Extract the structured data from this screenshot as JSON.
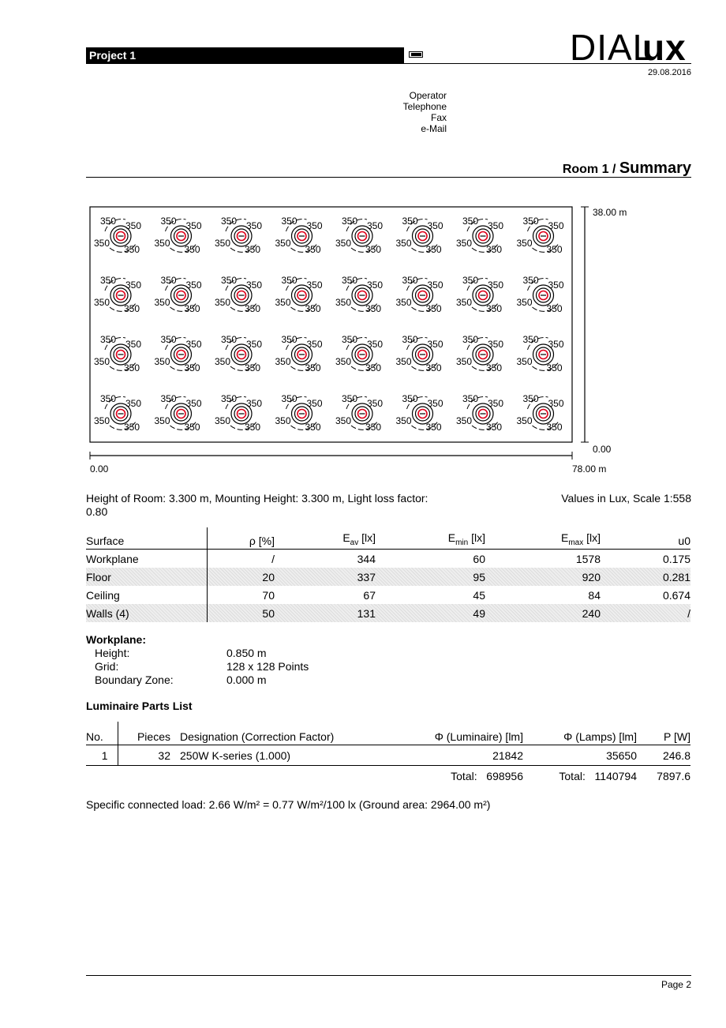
{
  "header": {
    "project": "Project 1",
    "logo": "DIALux",
    "date": "29.08.2016",
    "contact": [
      "Operator",
      "Telephone",
      "Fax",
      "e-Mail"
    ]
  },
  "section": {
    "room": "Room 1 /",
    "title": "Summary"
  },
  "plan": {
    "iso_label": "350",
    "y_max_label": "38.00 m",
    "y_min_label": "0.00",
    "x_min_label": "0.00",
    "x_max_label": "78.00 m",
    "luminaire_grid": {
      "columns": 8,
      "rows": 4
    },
    "luminaire_icon": "luminaire-symbol-icon"
  },
  "info": {
    "room_params": "Height of Room: 3.300 m, Mounting Height: 3.300 m, Light loss factor:",
    "room_params_2": "0.80",
    "scale": "Values in Lux, Scale 1:558"
  },
  "surfaces": {
    "headers": [
      "Surface",
      "ρ [%]",
      "E",
      "av",
      " [lx]",
      "E",
      "min",
      " [lx]",
      "E",
      "max",
      " [lx]",
      "u0"
    ],
    "rows": [
      [
        "Workplane",
        "/",
        "344",
        "60",
        "1578",
        "0.175"
      ],
      [
        "Floor",
        "20",
        "337",
        "95",
        "920",
        "0.281"
      ],
      [
        "Ceiling",
        "70",
        "67",
        "45",
        "84",
        "0.674"
      ],
      [
        "Walls (4)",
        "50",
        "131",
        "49",
        "240",
        "/"
      ]
    ]
  },
  "workplane": {
    "title": "Workplane:",
    "fields": [
      [
        "Height:",
        "0.850 m"
      ],
      [
        "Grid:",
        "128 x 128 Points"
      ],
      [
        "Boundary Zone:",
        "0.000 m"
      ]
    ]
  },
  "parts": {
    "title": "Luminaire Parts List",
    "headers": [
      "No.",
      "Pieces",
      "Designation (Correction Factor)",
      "Φ (Luminaire) [lm]",
      "Φ (Lamps) [lm]",
      "P [W]"
    ],
    "rows": [
      [
        "1",
        "32",
        "250W K-series (1.000)",
        "21842",
        "35650",
        "246.8"
      ]
    ],
    "totals": [
      "Total:",
      "698956",
      "Total:",
      "1140794",
      "7897.6"
    ]
  },
  "specific_load": "Specific connected load: 2.66 W/m² = 0.77 W/m²/100 lx (Ground area: 2964.00 m²)",
  "footer": {
    "page": "Page 2"
  },
  "colors": {
    "luminaire_mark": "#e0001a",
    "shade": "#e6e6e6"
  }
}
